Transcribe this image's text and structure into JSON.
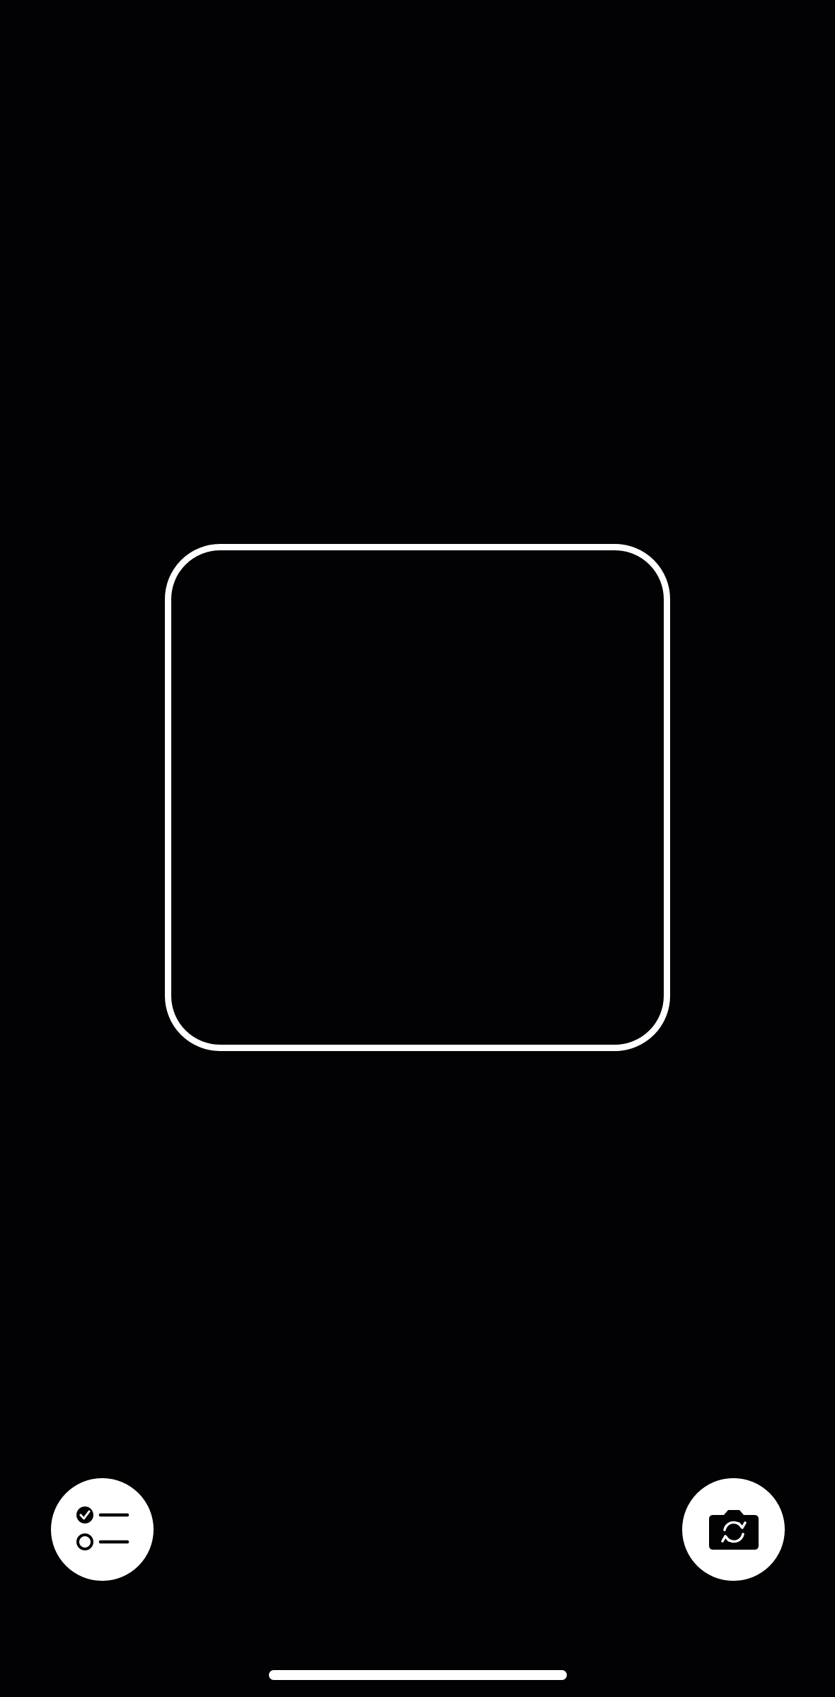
{
  "scanner": {
    "frame": "scan-frame"
  },
  "controls": {
    "checklist_button": {
      "icon": "checklist-icon"
    },
    "flip_camera_button": {
      "icon": "camera-flip-icon"
    }
  },
  "system": {
    "home_indicator": "home-indicator"
  },
  "colors": {
    "background": "#020103",
    "foreground": "#ffffff"
  }
}
